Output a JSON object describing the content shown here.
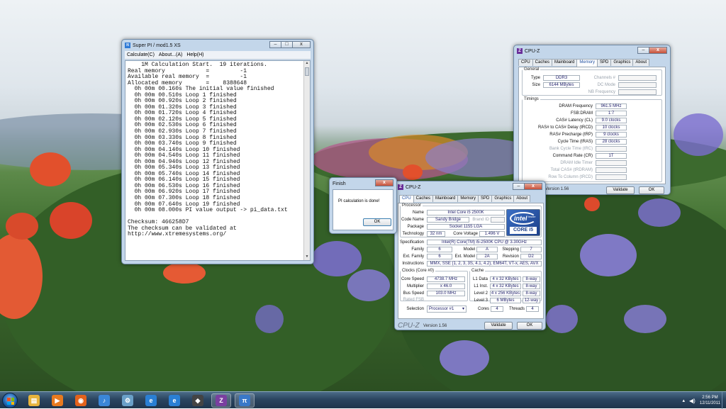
{
  "superpi": {
    "title": "Super PI / mod1.5 XS",
    "menu": [
      "Calculate(C)",
      "About...(A)",
      "Help(H)"
    ],
    "console_lines": [
      "    1M Calculation Start.  19 iterations.",
      "Real memory            =         -1",
      "Available real memory  =         -1",
      "Allocated memory       =    8388648",
      "  0h 00m 00.160s The initial value finished",
      "  0h 00m 00.510s Loop 1 finished",
      "  0h 00m 00.920s Loop 2 finished",
      "  0h 00m 01.320s Loop 3 finished",
      "  0h 00m 01.720s Loop 4 finished",
      "  0h 00m 02.120s Loop 5 finished",
      "  0h 00m 02.530s Loop 6 finished",
      "  0h 00m 02.930s Loop 7 finished",
      "  0h 00m 03.330s Loop 8 finished",
      "  0h 00m 03.740s Loop 9 finished",
      "  0h 00m 04.140s Loop 10 finished",
      "  0h 00m 04.540s Loop 11 finished",
      "  0h 00m 04.940s Loop 12 finished",
      "  0h 00m 05.340s Loop 13 finished",
      "  0h 00m 05.740s Loop 14 finished",
      "  0h 00m 06.140s Loop 15 finished",
      "  0h 00m 06.530s Loop 16 finished",
      "  0h 00m 06.920s Loop 17 finished",
      "  0h 00m 07.300s Loop 18 finished",
      "  0h 00m 07.640s Loop 19 finished",
      "  0h 00m 08.000s PI value output -> pi_data.txt",
      "",
      "Checksum: 466258D7",
      "The checksum can be validated at",
      "http://www.xtremesystems.org/"
    ]
  },
  "finish_dialog": {
    "title": "Finish",
    "message": "PI calculation is done!",
    "ok_label": "OK"
  },
  "cpuz_memory": {
    "title": "CPU-Z",
    "tabs": [
      "CPU",
      "Caches",
      "Mainboard",
      "Memory",
      "SPD",
      "Graphics",
      "About"
    ],
    "active_tab": "Memory",
    "general_legend": "General",
    "type_label": "Type",
    "type_value": "DDR3",
    "size_label": "Size",
    "size_value": "6144 MBytes",
    "channels_label": "Channels #",
    "dc_mode_label": "DC Mode",
    "nb_freq_label": "NB Frequency",
    "timings_legend": "Timings",
    "timings": [
      {
        "label": "DRAM Frequency",
        "value": "961.5 MHz",
        "dim": false
      },
      {
        "label": "FSB:DRAM",
        "value": "1:7",
        "dim": false
      },
      {
        "label": "CAS# Latency (CL)",
        "value": "9.0 clocks",
        "dim": false
      },
      {
        "label": "RAS# to CAS# Delay (tRCD)",
        "value": "10 clocks",
        "dim": false
      },
      {
        "label": "RAS# Precharge (tRP)",
        "value": "9 clocks",
        "dim": false
      },
      {
        "label": "Cycle Time (tRAS)",
        "value": "28 clocks",
        "dim": false
      },
      {
        "label": "Bank Cycle Time (tRC)",
        "value": "",
        "dim": true
      },
      {
        "label": "Command Rate (CR)",
        "value": "1T",
        "dim": false
      },
      {
        "label": "DRAM Idle Timer",
        "value": "",
        "dim": true
      },
      {
        "label": "Total CAS# (tRDRAM)",
        "value": "",
        "dim": true
      },
      {
        "label": "Row To Column (tRCD)",
        "value": "",
        "dim": true
      }
    ],
    "version": "Version 1.56",
    "validate_label": "Validate",
    "ok_label": "OK"
  },
  "cpuz_cpu": {
    "title": "CPU-Z",
    "tabs": [
      "CPU",
      "Caches",
      "Mainboard",
      "Memory",
      "SPD",
      "Graphics",
      "About"
    ],
    "active_tab": "CPU",
    "processor_legend": "Processor",
    "name_label": "Name",
    "name_value": "Intel Core i5 2500K",
    "codename_label": "Code Name",
    "codename_value": "Sandy Bridge",
    "brand_id_label": "Brand ID",
    "package_label": "Package",
    "package_value": "Socket 1155 LGA",
    "technology_label": "Technology",
    "technology_value": "32 nm",
    "core_voltage_label": "Core Voltage",
    "core_voltage_value": "1.496 V",
    "intel_logo": {
      "brand": "intel",
      "inside": "inside",
      "model": "CORE i5"
    },
    "specification_label": "Specification",
    "specification_value": "Intel(R) Core(TM) i5-2500K CPU @ 3.30GHz",
    "family_label": "Family",
    "family_value": "6",
    "model_label": "Model",
    "model_value": "A",
    "stepping_label": "Stepping",
    "stepping_value": "7",
    "ext_family_label": "Ext. Family",
    "ext_family_value": "6",
    "ext_model_label": "Ext. Model",
    "ext_model_value": "2A",
    "revision_label": "Revision",
    "revision_value": "D2",
    "instructions_label": "Instructions",
    "instructions_value": "MMX, SSE (1, 2, 3, 3S, 4.1, 4.2), EM64T, VT-x, AES, AVX",
    "clocks_legend": "Clocks (Core #0)",
    "core_speed_label": "Core Speed",
    "core_speed_value": "4738.7 MHz",
    "multiplier_label": "Multiplier",
    "multiplier_value": "x 46.0",
    "bus_speed_label": "Bus Speed",
    "bus_speed_value": "103.0 MHz",
    "rated_fsb_label": "Rated FSB",
    "cache_legend": "Cache",
    "caches": [
      {
        "label": "L1 Data",
        "size": "4 x 32 KBytes",
        "way": "8-way"
      },
      {
        "label": "L1 Inst.",
        "size": "4 x 32 KBytes",
        "way": "8-way"
      },
      {
        "label": "Level 2",
        "size": "4 x 256 KBytes",
        "way": "8-way"
      },
      {
        "label": "Level 3",
        "size": "6 MBytes",
        "way": "12-way"
      }
    ],
    "selection_label": "Selection",
    "selection_value": "Processor #1",
    "cores_label": "Cores",
    "cores_value": "4",
    "threads_label": "Threads",
    "threads_value": "4",
    "logo_text": "CPU-Z",
    "version": "Version 1.56",
    "validate_label": "Validate",
    "ok_label": "OK"
  },
  "taskbar": {
    "items": [
      {
        "name": "explorer-folder-icon",
        "color": "#e7b43c",
        "active": false
      },
      {
        "name": "media-player-icon",
        "color": "#e77a1f",
        "active": false
      },
      {
        "name": "firefox-icon",
        "color": "#e3621c",
        "active": false
      },
      {
        "name": "itunes-icon",
        "color": "#3a86d8",
        "active": false
      },
      {
        "name": "network-icon",
        "color": "#6aa0c8",
        "active": false
      },
      {
        "name": "internet-explorer-icon",
        "color": "#2a7fd4",
        "active": false
      },
      {
        "name": "internet-explorer-icon-2",
        "color": "#2a7fd4",
        "active": false
      },
      {
        "name": "app-icon",
        "color": "#444444",
        "active": false
      },
      {
        "name": "cpuz-icon",
        "color": "#7a3fa0",
        "active": true
      },
      {
        "name": "superpi-icon",
        "color": "#3a78c8",
        "active": true
      }
    ],
    "clock_time": "2:56 PM",
    "clock_date": "12/11/2011"
  }
}
